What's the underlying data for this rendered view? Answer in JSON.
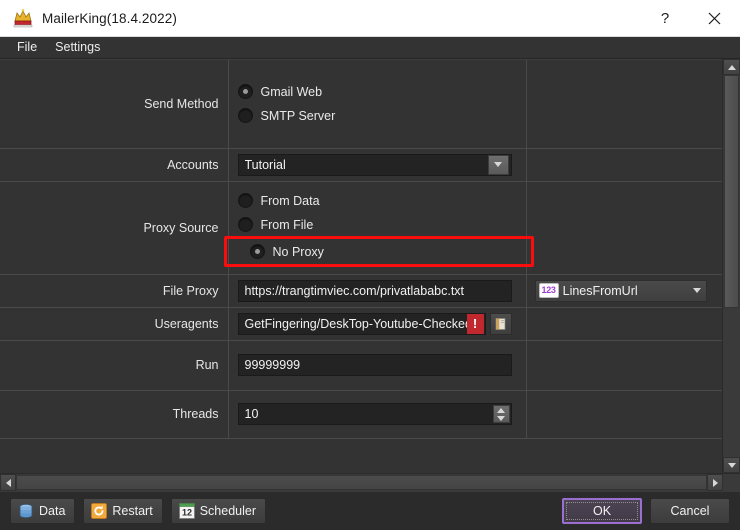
{
  "window": {
    "title": "MailerKing(18.4.2022)",
    "app_icon": "crown-icon",
    "help_label": "?",
    "close_label": "✕"
  },
  "menubar": {
    "items": [
      {
        "label": "File",
        "name": "menu-file"
      },
      {
        "label": "Settings",
        "name": "menu-settings"
      }
    ]
  },
  "form": {
    "rows": [
      {
        "label": "Send Method",
        "type": "radio-group",
        "options": [
          {
            "label": "Gmail Web",
            "selected": true
          },
          {
            "label": "SMTP Server",
            "selected": false
          }
        ]
      },
      {
        "label": "Accounts",
        "type": "combo",
        "value": "Tutorial"
      },
      {
        "label": "Proxy Source",
        "type": "radio-group",
        "highlighted_option": "No Proxy",
        "options": [
          {
            "label": "From Data",
            "selected": false
          },
          {
            "label": "From File",
            "selected": false
          },
          {
            "label": "No Proxy",
            "selected": true
          }
        ]
      },
      {
        "label": "File Proxy",
        "type": "text",
        "value": "https://trangtimviec.com/privatlababc.txt",
        "extra": {
          "type": "type-combo",
          "badge": "123",
          "value": "LinesFromUrl"
        }
      },
      {
        "label": "Useragents",
        "type": "text-with-error",
        "value": "GetFingering/DeskTop-Youtube-Checked.",
        "error_badge": "!",
        "browse_icon": "folder-icon"
      },
      {
        "label": "Run",
        "type": "text",
        "value": "99999999"
      },
      {
        "label": "Threads",
        "type": "spinner",
        "value": "10"
      }
    ]
  },
  "bottombar": {
    "tools": [
      {
        "label": "Data",
        "icon": "database-icon"
      },
      {
        "label": "Restart",
        "icon": "restart-icon"
      },
      {
        "label": "Scheduler",
        "icon": "calendar-12-icon"
      }
    ],
    "ok_label": "OK",
    "cancel_label": "Cancel"
  },
  "colors": {
    "highlight": "#fb0d0d",
    "error_badge": "#c0282d",
    "primary_border": "#9b6fcf",
    "badge_text": "#a03fd8",
    "panel": "#333333",
    "window": "#2b2b2b"
  }
}
